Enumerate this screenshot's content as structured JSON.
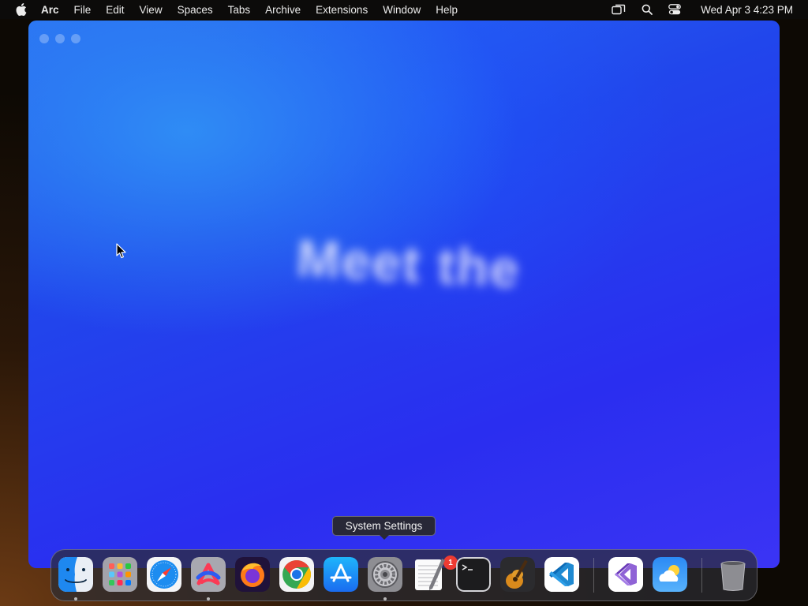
{
  "menubar": {
    "app_name": "Arc",
    "items": [
      "File",
      "Edit",
      "View",
      "Spaces",
      "Tabs",
      "Archive",
      "Extensions",
      "Window",
      "Help"
    ],
    "clock": "Wed Apr 3  4:23 PM",
    "status_icons": [
      "screen-mirroring-icon",
      "spotlight-search-icon",
      "control-center-icon"
    ]
  },
  "window": {
    "app": "Arc",
    "hero_text": "Meet the",
    "background_colors": [
      "#2f8cf5",
      "#2146ec",
      "#3b34f4"
    ]
  },
  "tooltip": {
    "text": "System Settings"
  },
  "dock": {
    "apps": [
      {
        "name": "Finder",
        "running": true
      },
      {
        "name": "Launchpad",
        "running": false
      },
      {
        "name": "Safari",
        "running": false
      },
      {
        "name": "Arc",
        "running": true
      },
      {
        "name": "Firefox",
        "running": false
      },
      {
        "name": "Google Chrome",
        "running": false
      },
      {
        "name": "App Store",
        "running": false
      },
      {
        "name": "System Settings",
        "running": true,
        "badge": "1"
      },
      {
        "name": "TextEdit",
        "running": false
      },
      {
        "name": "Terminal",
        "running": false
      },
      {
        "name": "GarageBand",
        "running": false
      },
      {
        "name": "Visual Studio Code",
        "running": false
      },
      {
        "name": "Visual Studio",
        "running": false
      },
      {
        "name": "Weather",
        "running": false
      },
      {
        "name": "Trash",
        "running": false
      }
    ],
    "system_settings_badge": "1"
  },
  "colors": {
    "badge_red": "#ee3b32",
    "menubar_bg": "#0c0b0a"
  }
}
